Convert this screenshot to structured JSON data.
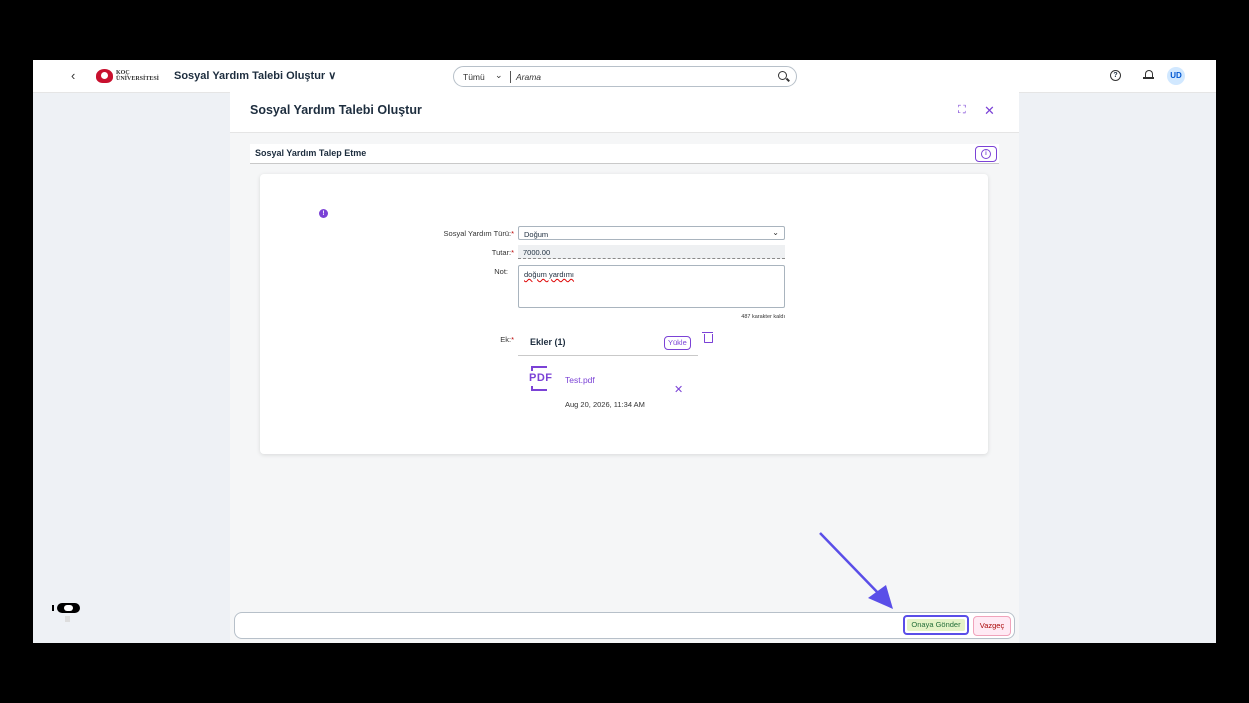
{
  "shell": {
    "back_icon": "‹",
    "logo_text_line1": "KOÇ",
    "logo_text_line2": "ÜNİVERSİTESİ",
    "app_title": "Sosyal Yardım Talebi Oluştur ∨",
    "search_scope": "Tümü",
    "search_placeholder": "Arama",
    "help_icon": "?",
    "avatar": "UD"
  },
  "dialog": {
    "title": "Sosyal Yardım Talebi Oluştur",
    "section_title": "Sosyal Yardım Talep Etme",
    "info_icon": "i",
    "form": {
      "type_label": "Sosyal Yardım Türü:",
      "type_value": "Doğum",
      "amount_label": "Tutar:",
      "amount_value": "7000.00",
      "note_label": "Not:",
      "note_value": "doğum yardımı",
      "counter": "487 karakter kaldı",
      "attachment_label": "Ek:",
      "required_mark": "*"
    },
    "attachments": {
      "title": "Ekler (1)",
      "upload_label": "Yükle",
      "files": [
        {
          "icon_text": "PDF",
          "name": "Test.pdf",
          "date": "Aug 20, 2026, 11:34 AM"
        }
      ]
    },
    "footer": {
      "submit_label": "Onaya Gönder",
      "cancel_label": "Vazgeç"
    }
  },
  "colors": {
    "accent": "#7b42d6",
    "highlight": "#5a4ee8",
    "submit_bg": "#e5f3c7",
    "cancel_bg": "#ffeaf4"
  }
}
